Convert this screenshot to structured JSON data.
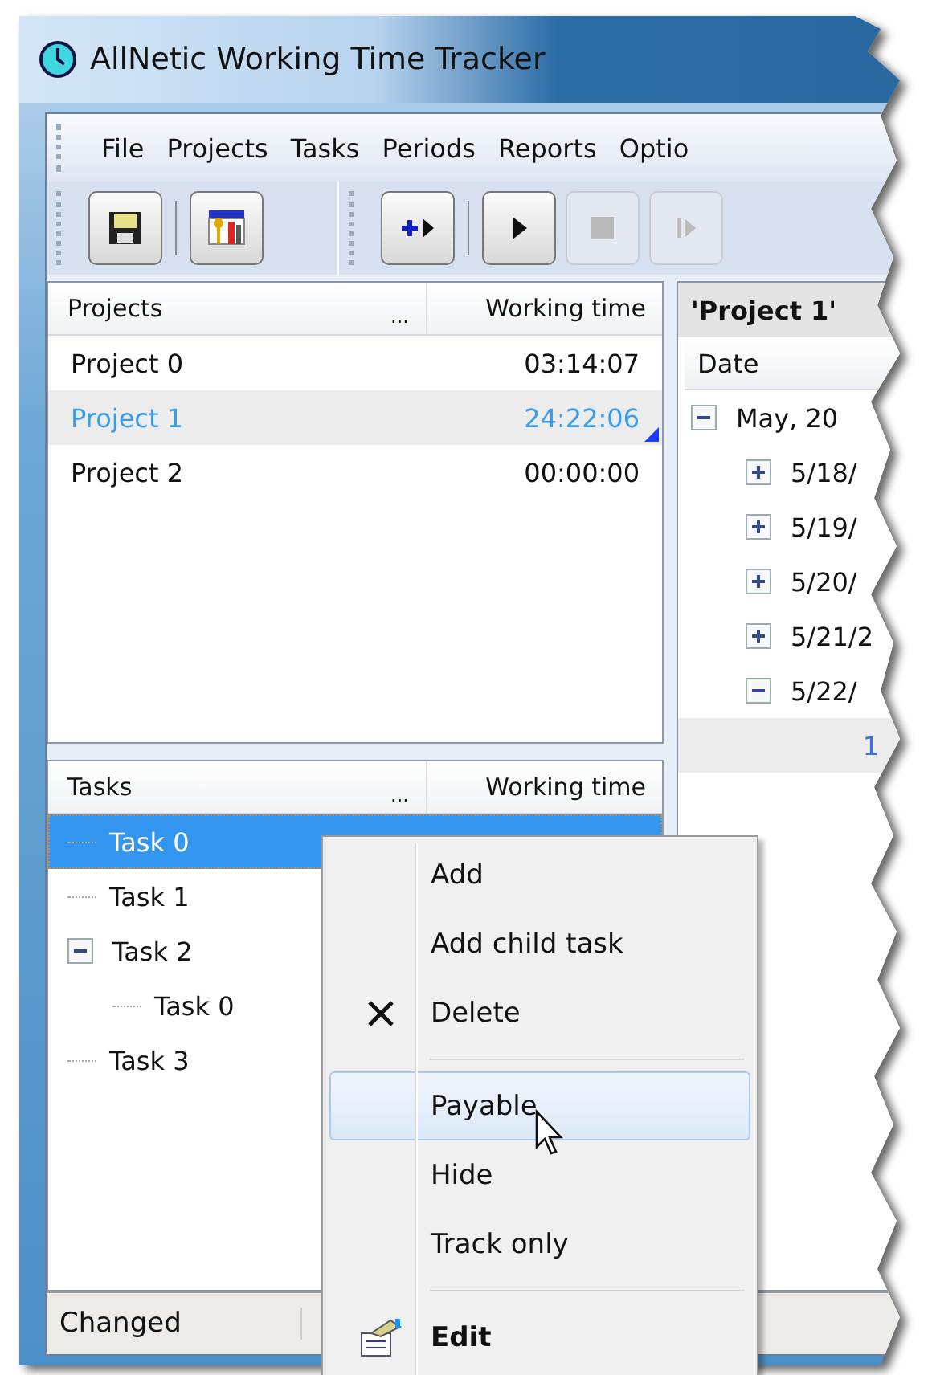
{
  "window": {
    "title": "AllNetic Working Time Tracker"
  },
  "menu_bar": [
    {
      "label": "File"
    },
    {
      "label": "Projects"
    },
    {
      "label": "Tasks"
    },
    {
      "label": "Periods"
    },
    {
      "label": "Reports"
    },
    {
      "label": "Optio"
    }
  ],
  "toolbar": [
    {
      "kind": "save",
      "disabled": false
    },
    {
      "kind": "settings",
      "disabled": false
    },
    {
      "kind": "add",
      "disabled": false
    },
    {
      "kind": "play",
      "disabled": false
    },
    {
      "kind": "stop",
      "disabled": true
    },
    {
      "kind": "step",
      "disabled": true
    }
  ],
  "projects_pane": {
    "columns": [
      "Projects",
      "Working time"
    ],
    "header_more": "...",
    "rows": [
      {
        "name": "Project 0",
        "time": "03:14:07",
        "selected": false
      },
      {
        "name": "Project 1",
        "time": "24:22:06",
        "selected": true
      },
      {
        "name": "Project 2",
        "time": "00:00:00",
        "selected": false
      }
    ]
  },
  "tasks_pane": {
    "columns": [
      "Tasks",
      "Working time"
    ],
    "header_more": "...",
    "tree": [
      {
        "label": "Task 0",
        "selected": true
      },
      {
        "label": "Task 1",
        "selected": false
      },
      {
        "label": "Task 2",
        "selected": false,
        "expanded": true,
        "children": [
          {
            "label": "Task 0",
            "selected": false
          }
        ]
      },
      {
        "label": "Task 3",
        "selected": false
      }
    ]
  },
  "detail_pane": {
    "title": "'Project 1'",
    "columns": [
      "Date"
    ],
    "tree": [
      {
        "label": "May, 20",
        "selected": false,
        "expanded": true,
        "children": [
          {
            "label": "5/18/",
            "selected": false,
            "expanded": false
          },
          {
            "label": "5/19/",
            "selected": false,
            "expanded": false
          },
          {
            "label": "5/20/",
            "selected": false,
            "expanded": false
          },
          {
            "label": "5/21/2",
            "selected": false,
            "expanded": false
          },
          {
            "label": "5/22/",
            "selected": false,
            "expanded": true,
            "children": [
              {
                "label": "1",
                "selected": true
              }
            ]
          }
        ]
      }
    ]
  },
  "context_menu": [
    {
      "kind": "plain",
      "label": "Add",
      "selected": false,
      "default": false
    },
    {
      "kind": "plain",
      "label": "Add child task",
      "selected": false,
      "default": false
    },
    {
      "kind": "delete",
      "label": "Delete",
      "selected": false,
      "default": false
    },
    {
      "kind": "separator"
    },
    {
      "kind": "plain",
      "label": "Payable",
      "selected": true,
      "default": false
    },
    {
      "kind": "plain",
      "label": "Hide",
      "selected": false,
      "default": false
    },
    {
      "kind": "plain",
      "label": "Track only",
      "selected": false,
      "default": false
    },
    {
      "kind": "separator"
    },
    {
      "kind": "edit",
      "label": "Edit",
      "selected": false,
      "default": true
    }
  ],
  "status_bar": [
    "Changed"
  ]
}
